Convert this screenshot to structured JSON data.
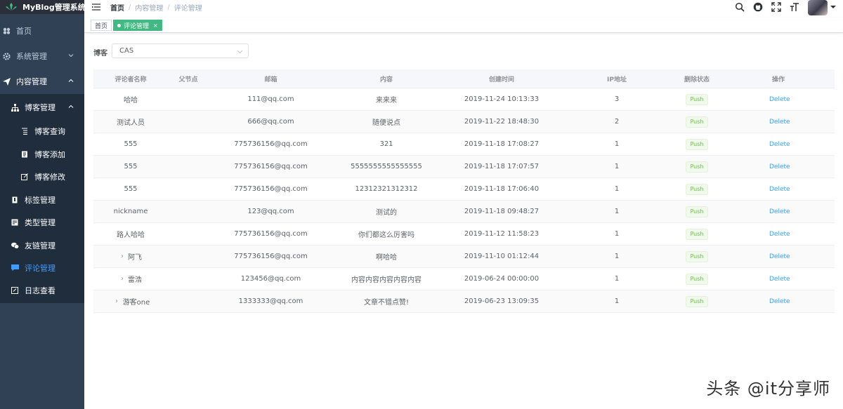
{
  "app": {
    "title": "MyBlog管理系统"
  },
  "sidebar": {
    "items": [
      {
        "label": "首页",
        "icon": "dashboard-icon"
      },
      {
        "label": "系统管理",
        "icon": "gear-icon"
      },
      {
        "label": "内容管理",
        "icon": "send-icon"
      },
      {
        "label": "博客管理",
        "icon": "tree-icon"
      },
      {
        "label": "博客查询",
        "icon": "list-icon"
      },
      {
        "label": "博客添加",
        "icon": "doc-icon"
      },
      {
        "label": "博客修改",
        "icon": "edit-icon"
      },
      {
        "label": "标签管理",
        "icon": "tag-icon"
      },
      {
        "label": "类型管理",
        "icon": "type-icon"
      },
      {
        "label": "友链管理",
        "icon": "chat-icon"
      },
      {
        "label": "评论管理",
        "icon": "comment-icon"
      },
      {
        "label": "日志查看",
        "icon": "log-icon"
      }
    ]
  },
  "breadcrumb": {
    "items": [
      "首页",
      "内容管理",
      "评论管理"
    ]
  },
  "tags": {
    "items": [
      "首页",
      "评论管理"
    ],
    "close": "×"
  },
  "filter": {
    "label": "博客",
    "value": "CAS"
  },
  "table": {
    "headers": [
      "评论者名称",
      "父节点",
      "邮箱",
      "内容",
      "创建时间",
      "IP地址",
      "删除状态",
      "操作"
    ],
    "push_label": "Push",
    "delete_label": "Delete",
    "rows": [
      {
        "name": "哈哈",
        "email": "111@qq.com",
        "content": "来来来",
        "time": "2019-11-24 10:13:33",
        "ip": "3",
        "expand": ""
      },
      {
        "name": "测试人员",
        "email": "666@qq.com",
        "content": "随便说点",
        "time": "2019-11-22 18:48:30",
        "ip": "2",
        "expand": ""
      },
      {
        "name": "555",
        "email": "775736156@qq.com",
        "content": "321",
        "time": "2019-11-18 17:08:27",
        "ip": "1",
        "expand": ""
      },
      {
        "name": "555",
        "email": "775736156@qq.com",
        "content": "5555555555555555",
        "time": "2019-11-18 17:07:57",
        "ip": "1",
        "expand": ""
      },
      {
        "name": "555",
        "email": "775736156@qq.com",
        "content": "12312321312312",
        "time": "2019-11-18 17:06:40",
        "ip": "1",
        "expand": ""
      },
      {
        "name": "nickname",
        "email": "123@qq.com",
        "content": "测试的",
        "time": "2019-11-18 09:48:27",
        "ip": "1",
        "expand": ""
      },
      {
        "name": "路人哈哈",
        "email": "775736156@qq.com",
        "content": "你们都这么厉害吗",
        "time": "2019-11-12 11:58:23",
        "ip": "1",
        "expand": ""
      },
      {
        "name": "阿飞",
        "email": "775736156@qq.com",
        "content": "啊哈哈",
        "time": "2019-11-10 01:12:44",
        "ip": "1",
        "expand": "›"
      },
      {
        "name": "雷浩",
        "email": "123456@qq.com",
        "content": "内容内容内容内容内容",
        "time": "2019-06-24 00:00:00",
        "ip": "1",
        "expand": "›"
      },
      {
        "name": "游客one",
        "email": "1333333@qq.com",
        "content": "文章不错点赞!",
        "time": "2019-06-23 13:09:35",
        "ip": "1",
        "expand": "›"
      }
    ]
  },
  "watermark": "头条 @it分享师",
  "colors": {
    "sidebar": "#304156",
    "accent": "#409eff",
    "tag_active": "#42b983",
    "push": "#67c23a"
  }
}
